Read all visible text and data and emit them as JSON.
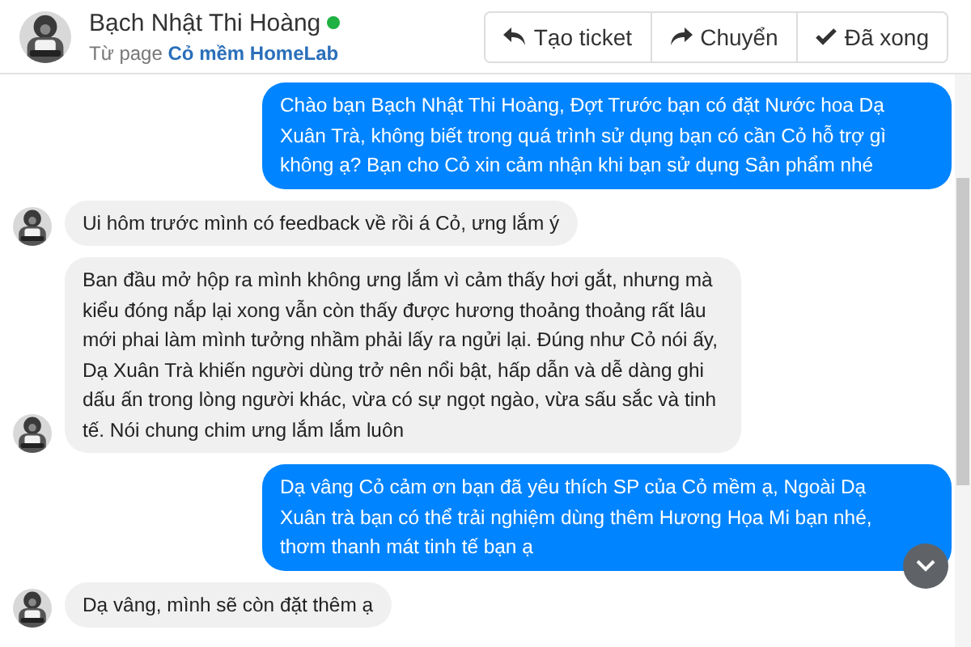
{
  "header": {
    "name": "Bạch Nhật Thi Hoàng",
    "online": true,
    "source_prefix": "Từ page",
    "source_page": "Cỏ mềm HomeLab"
  },
  "actions": [
    {
      "kind": "reply",
      "label": "Tạo ticket"
    },
    {
      "kind": "forward",
      "label": "Chuyển"
    },
    {
      "kind": "done",
      "label": "Đã xong"
    }
  ],
  "messages": [
    {
      "kind": "outgoing",
      "text": "Chào bạn Bạch Nhật Thi Hoàng, Đợt Trước bạn có đặt Nước hoa Dạ Xuân Trà, không biết trong quá trình sử dụng bạn có cần Cỏ hỗ trợ gì không ạ? Bạn cho Cỏ xin cảm nhận khi bạn sử dụng Sản phẩm nhé"
    },
    {
      "kind": "incoming",
      "text": "Ui hôm trước mình có feedback về rồi á Cỏ, ưng lắm ý"
    },
    {
      "kind": "incoming",
      "text": "Ban đầu mở hộp ra mình không ưng lắm vì cảm thấy hơi gắt, nhưng mà kiểu đóng nắp lại xong vẫn còn thấy được hương thoảng thoảng rất lâu mới phai làm mình tưởng nhầm phải lấy ra ngửi lại. Đúng như Cỏ nói ấy, Dạ Xuân Trà khiến người dùng trở nên nổi bật, hấp dẫn và dễ dàng ghi dấu ấn trong lòng người khác, vừa có sự ngọt ngào, vừa sấu sắc và tinh tế. Nói chung chim ưng lắm lắm luôn"
    },
    {
      "kind": "outgoing",
      "text": "Dạ vâng Cỏ cảm ơn bạn đã yêu thích SP của Cỏ mềm ạ, Ngoài Dạ Xuân trà bạn có thể trải nghiệm dùng thêm Hương Họa Mi bạn nhé, thơm thanh mát tinh tế bạn ạ"
    },
    {
      "kind": "incoming",
      "text": "Dạ vâng, mình sẽ còn đặt thêm ạ"
    }
  ]
}
